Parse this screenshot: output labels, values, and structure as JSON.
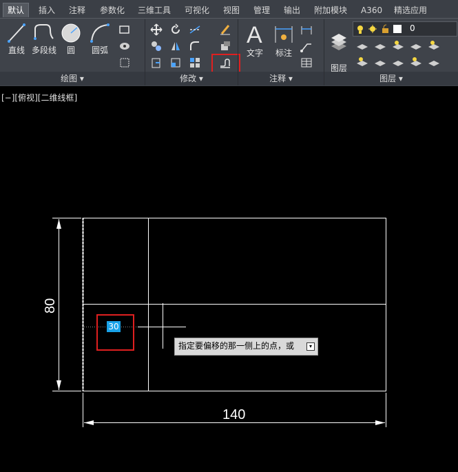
{
  "tabs": [
    "默认",
    "插入",
    "注释",
    "参数化",
    "三维工具",
    "可视化",
    "视图",
    "管理",
    "输出",
    "附加模块",
    "A360",
    "精选应用"
  ],
  "draw_group": {
    "label": "绘图 ▾",
    "buttons": [
      "直线",
      "多段线",
      "圆",
      "圆弧"
    ]
  },
  "modify_group": {
    "label": "修改 ▾"
  },
  "annotate_group": {
    "label": "注释 ▾",
    "buttons": [
      "文字",
      "标注"
    ]
  },
  "layer_group": {
    "label": "图层 ▾",
    "layer_props": "图层\n特性",
    "current_layer": "0"
  },
  "viewport": {
    "label": "[−][俯视][二维线框]"
  },
  "dimensions": {
    "width": "140",
    "height": "80"
  },
  "command": {
    "input_value": "30",
    "tooltip": "指定要偏移的那一侧上的点，或"
  },
  "colors": {
    "highlight": "#e02020",
    "input_bg": "#1aa2e8",
    "ribbon": "#3f434a"
  }
}
